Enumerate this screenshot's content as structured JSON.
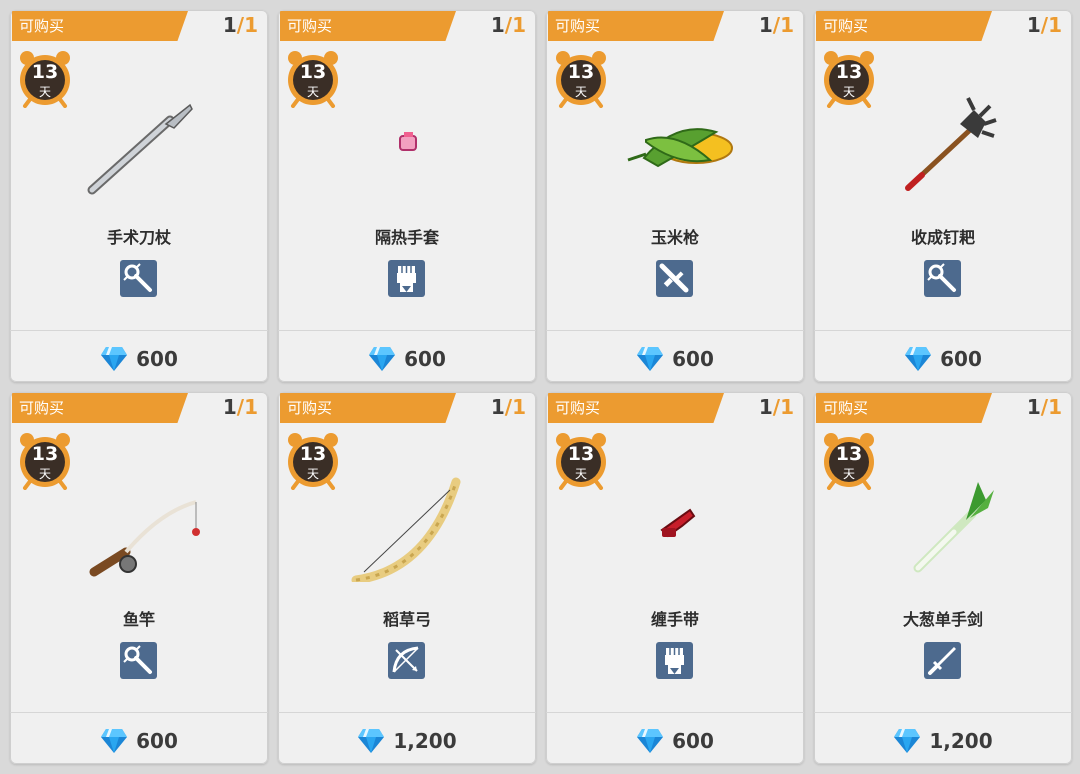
{
  "items": [
    {
      "status_label": "可购买",
      "stock_current": "1",
      "stock_sep": "/",
      "stock_total": "1",
      "timer_value": "13",
      "timer_unit": "天",
      "name": "手术刀杖",
      "price": "600",
      "type_icon": "staff-icon",
      "art_icon": "scalpel-staff-icon"
    },
    {
      "status_label": "可购买",
      "stock_current": "1",
      "stock_sep": "/",
      "stock_total": "1",
      "timer_value": "13",
      "timer_unit": "天",
      "name": "隔热手套",
      "price": "600",
      "type_icon": "gauntlet-icon",
      "art_icon": "heat-glove-icon"
    },
    {
      "status_label": "可购买",
      "stock_current": "1",
      "stock_sep": "/",
      "stock_total": "1",
      "timer_value": "13",
      "timer_unit": "天",
      "name": "玉米枪",
      "price": "600",
      "type_icon": "rifle-icon",
      "art_icon": "corn-gun-icon"
    },
    {
      "status_label": "可购买",
      "stock_current": "1",
      "stock_sep": "/",
      "stock_total": "1",
      "timer_value": "13",
      "timer_unit": "天",
      "name": "收成钉耙",
      "price": "600",
      "type_icon": "staff-icon",
      "art_icon": "harvest-rake-icon"
    },
    {
      "status_label": "可购买",
      "stock_current": "1",
      "stock_sep": "/",
      "stock_total": "1",
      "timer_value": "13",
      "timer_unit": "天",
      "name": "鱼竿",
      "price": "600",
      "type_icon": "staff-icon",
      "art_icon": "fishing-rod-icon"
    },
    {
      "status_label": "可购买",
      "stock_current": "1",
      "stock_sep": "/",
      "stock_total": "1",
      "timer_value": "13",
      "timer_unit": "天",
      "name": "稻草弓",
      "price": "1,200",
      "type_icon": "bow-icon",
      "art_icon": "straw-bow-icon"
    },
    {
      "status_label": "可购买",
      "stock_current": "1",
      "stock_sep": "/",
      "stock_total": "1",
      "timer_value": "13",
      "timer_unit": "天",
      "name": "缠手带",
      "price": "600",
      "type_icon": "gauntlet-icon",
      "art_icon": "hand-wrap-icon"
    },
    {
      "status_label": "可购买",
      "stock_current": "1",
      "stock_sep": "/",
      "stock_total": "1",
      "timer_value": "13",
      "timer_unit": "天",
      "name": "大葱单手剑",
      "price": "1,200",
      "type_icon": "sword-icon",
      "art_icon": "leek-sword-icon"
    }
  ],
  "currency_icon": "diamond-gem-icon",
  "colors": {
    "ribbon": "#ec9b30",
    "badge": "#4d6a8e",
    "gem": "#2aa6f0",
    "timer": "#3a2e26"
  }
}
